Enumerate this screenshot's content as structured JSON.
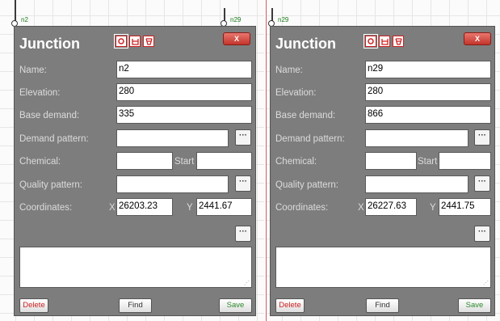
{
  "left": {
    "node_label": "n2",
    "title": "Junction",
    "close_label": "X",
    "labels": {
      "name": "Name:",
      "elevation": "Elevation:",
      "base_demand": "Base demand:",
      "demand_pattern": "Demand pattern:",
      "chemical": "Chemical:",
      "start": "Start",
      "quality_pattern": "Quality pattern:",
      "coordinates": "Coordinates:",
      "x": "X",
      "y": "Y"
    },
    "values": {
      "name": "n2",
      "elevation": "280",
      "base_demand": "335",
      "demand_pattern": "",
      "chemical": "",
      "start": "",
      "quality_pattern": "",
      "x": "26203.23",
      "y": "2441.67",
      "notes": ""
    },
    "dots_label": "···",
    "buttons": {
      "delete": "Delete",
      "find": "Find",
      "save": "Save"
    }
  },
  "right": {
    "node_label": "n29",
    "title": "Junction",
    "close_label": "X",
    "labels": {
      "name": "Name:",
      "elevation": "Elevation:",
      "base_demand": "Base demand:",
      "demand_pattern": "Demand pattern:",
      "chemical": "Chemical:",
      "start": "Start",
      "quality_pattern": "Quality pattern:",
      "coordinates": "Coordinates:",
      "x": "X",
      "y": "Y"
    },
    "values": {
      "name": "n29",
      "elevation": "280",
      "base_demand": "866",
      "demand_pattern": "",
      "chemical": "",
      "start": "",
      "quality_pattern": "",
      "x": "26227.63",
      "y": "2441.75",
      "notes": ""
    },
    "dots_label": "···",
    "buttons": {
      "delete": "Delete",
      "find": "Find",
      "save": "Save"
    }
  },
  "left_canvas_extra_node_label": "n29",
  "colors": {
    "panel": "#7d7d7d",
    "accent_red": "#cc2222",
    "node_label_green": "#1a7a1a",
    "save_green": "#2a8a2a"
  },
  "icons": [
    "junction-icon",
    "tank-icon",
    "reservoir-icon"
  ]
}
